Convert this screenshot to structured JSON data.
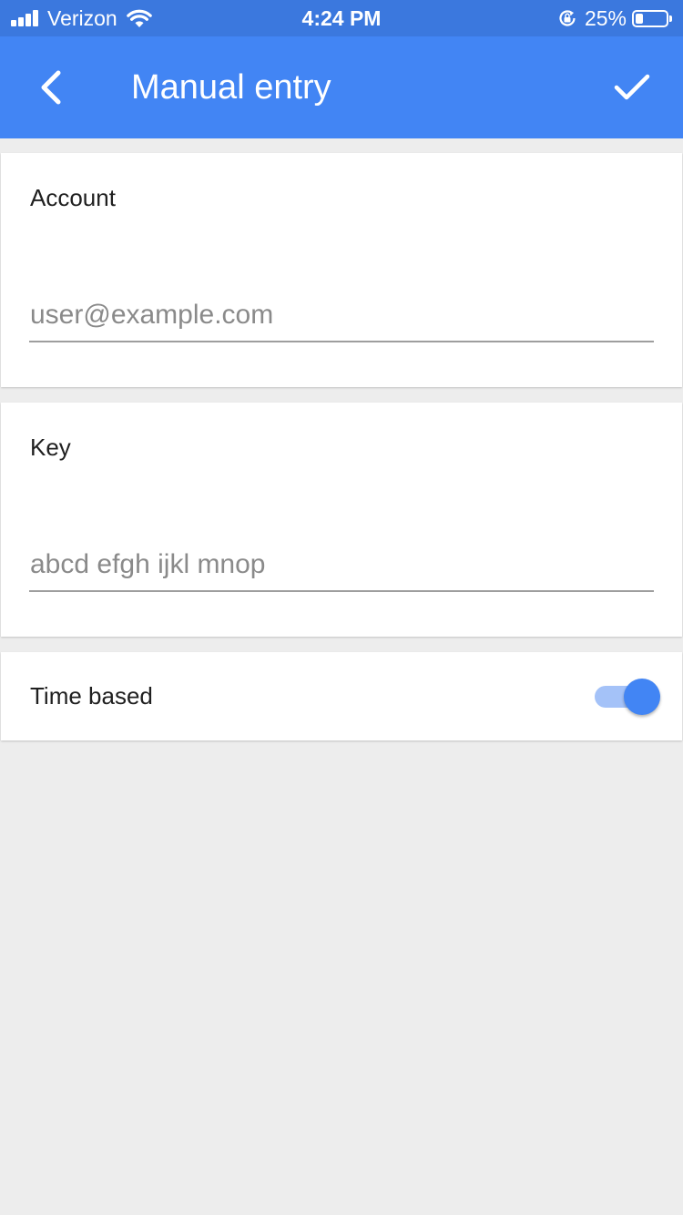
{
  "status_bar": {
    "carrier": "Verizon",
    "time": "4:24 PM",
    "battery_percent": "25%",
    "battery_level": 0.25,
    "icons": [
      "signal-icon",
      "wifi-icon",
      "orientation-lock-icon",
      "battery-icon"
    ]
  },
  "app_bar": {
    "title": "Manual entry",
    "back_icon": "chevron-left-icon",
    "confirm_icon": "check-icon",
    "color": "#4285f4"
  },
  "account": {
    "label": "Account",
    "placeholder": "user@example.com",
    "value": ""
  },
  "key": {
    "label": "Key",
    "placeholder": "abcd efgh ijkl mnop",
    "value": ""
  },
  "time_based": {
    "label": "Time based",
    "enabled": true
  },
  "colors": {
    "status_bar": "#3b78de",
    "accent": "#4285f4",
    "background": "#ededed"
  }
}
